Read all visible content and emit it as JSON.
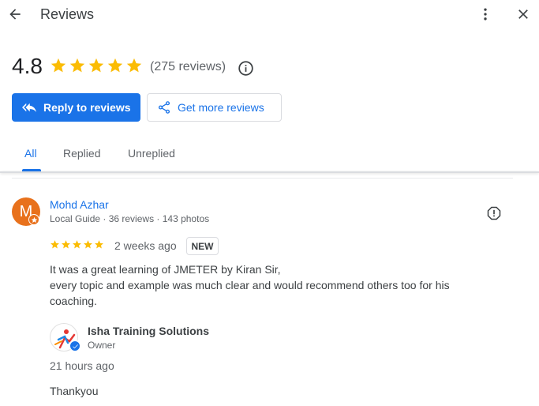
{
  "header": {
    "title": "Reviews",
    "back_icon": "arrow-back-icon",
    "more_icon": "more-vert-icon",
    "close_icon": "close-icon"
  },
  "summary": {
    "rating": "4.8",
    "stars": 5,
    "review_count": "(275 reviews)",
    "info_icon": "info-icon"
  },
  "actions": {
    "reply_label": "Reply to reviews",
    "reply_icon": "reply-all-icon",
    "get_more_label": "Get more reviews",
    "share_icon": "share-icon"
  },
  "tabs": [
    {
      "label": "All",
      "active": true
    },
    {
      "label": "Replied",
      "active": false
    },
    {
      "label": "Unreplied",
      "active": false
    }
  ],
  "review": {
    "avatar_letter": "M",
    "author": "Mohd Azhar",
    "meta": "Local Guide · 36 reviews · 143 photos",
    "stars": 5,
    "time": "2 weeks ago",
    "badge": "NEW",
    "text_lines": [
      "It was a great learning of JMETER by Kiran Sir,",
      "every topic and example was much clear and would recommend others too for his",
      "coaching."
    ],
    "report_icon": "report-icon"
  },
  "reply": {
    "owner_name": "Isha Training Solutions",
    "owner_role": "Owner",
    "time": "21 hours ago",
    "text": "Thankyou"
  },
  "colors": {
    "accent": "#1a73e8",
    "star": "#fbbc04",
    "avatar": "#e8711c"
  }
}
